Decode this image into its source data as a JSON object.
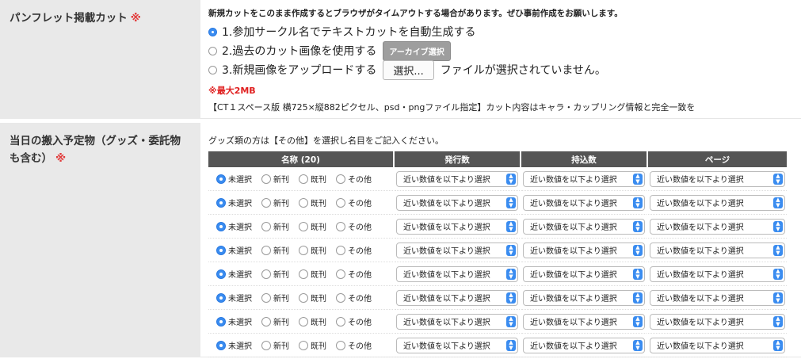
{
  "cut_section": {
    "label": "パンフレット掲載カット",
    "required_mark": "※",
    "note": "新規カットをこのまま作成するとブラウザがタイムアウトする場合があります。ぜひ事前作成をお願いします。",
    "options": [
      {
        "label": "1.参加サークル名でテキストカットを自動生成する",
        "checked": true
      },
      {
        "label": "2.過去のカット画像を使用する",
        "checked": false
      },
      {
        "label": "3.新規画像をアップロードする",
        "checked": false
      }
    ],
    "archive_button": "アーカイブ選択",
    "file_button": "選択...",
    "no_file_text": "ファイルが選択されていません。",
    "max_size": "※最大2MB",
    "spec": "【CT１スペース版 横725×縦882ピクセル、psd・pngファイル指定】カット内容はキャラ・カップリング情報と完全一致を"
  },
  "goods_section": {
    "label": "当日の搬入予定物（グッズ・委託物も含む）",
    "required_mark": "※",
    "note": "グッズ類の方は【その他】を選択し名目をご記入ください。",
    "headers": [
      "名称 (20)",
      "発行数",
      "持込数",
      "ページ"
    ],
    "radio_labels": [
      "未選択",
      "新刊",
      "既刊",
      "その他"
    ],
    "select_placeholder": "近い数値を以下より選択",
    "rows": [
      {
        "selected": "未選択"
      },
      {
        "selected": "未選択"
      },
      {
        "selected": "未選択"
      },
      {
        "selected": "未選択"
      },
      {
        "selected": "未選択"
      },
      {
        "selected": "未選択"
      },
      {
        "selected": "未選択"
      },
      {
        "selected": "未選択"
      }
    ]
  },
  "colors": {
    "accent": "#3a8cf0",
    "required": "#e23b3b",
    "header_bg": "#555555",
    "label_bg": "#e9e9e9"
  }
}
